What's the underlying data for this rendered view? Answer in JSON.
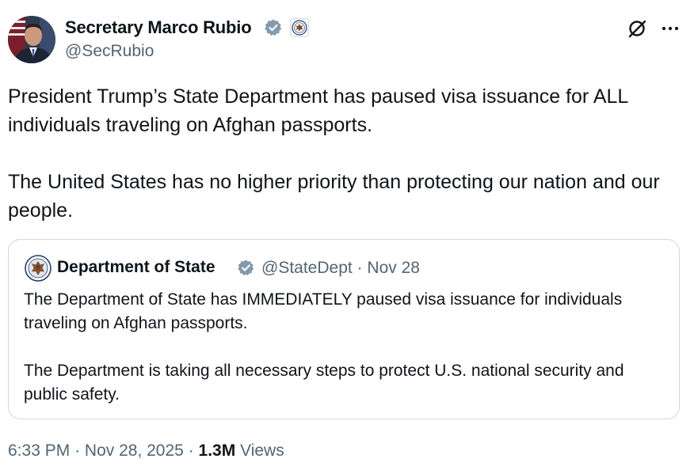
{
  "author": {
    "name": "Secretary Marco Rubio",
    "handle": "@SecRubio",
    "verified_badge_icon": "verified-badge-icon",
    "affiliate_badge_icon": "state-department-seal-icon",
    "badge_color": "#829aab"
  },
  "header_actions": {
    "grok_icon": "grok-icon",
    "more_icon": "more-options-icon"
  },
  "tweet": {
    "paragraphs": [
      "President Trump’s State Department has paused visa issuance for ALL individuals traveling on Afghan passports.",
      "The United States has no higher priority than protecting our nation and our people."
    ]
  },
  "quote": {
    "author_name": "Department of State",
    "handle": "@StateDept",
    "separator": "·",
    "date": "Nov 28",
    "paragraphs": [
      "The Department of State has IMMEDIATELY paused visa issuance for individuals traveling on Afghan passports.",
      "The Department is taking all necessary steps to protect U.S. national security and public safety."
    ]
  },
  "footer": {
    "time": "6:33 PM",
    "separator": "·",
    "date": "Nov 28, 2025",
    "views_count": "1.3M",
    "views_label": "Views"
  },
  "colors": {
    "text_primary": "#0f1419",
    "text_secondary": "#536471",
    "border": "#cfd9de"
  }
}
